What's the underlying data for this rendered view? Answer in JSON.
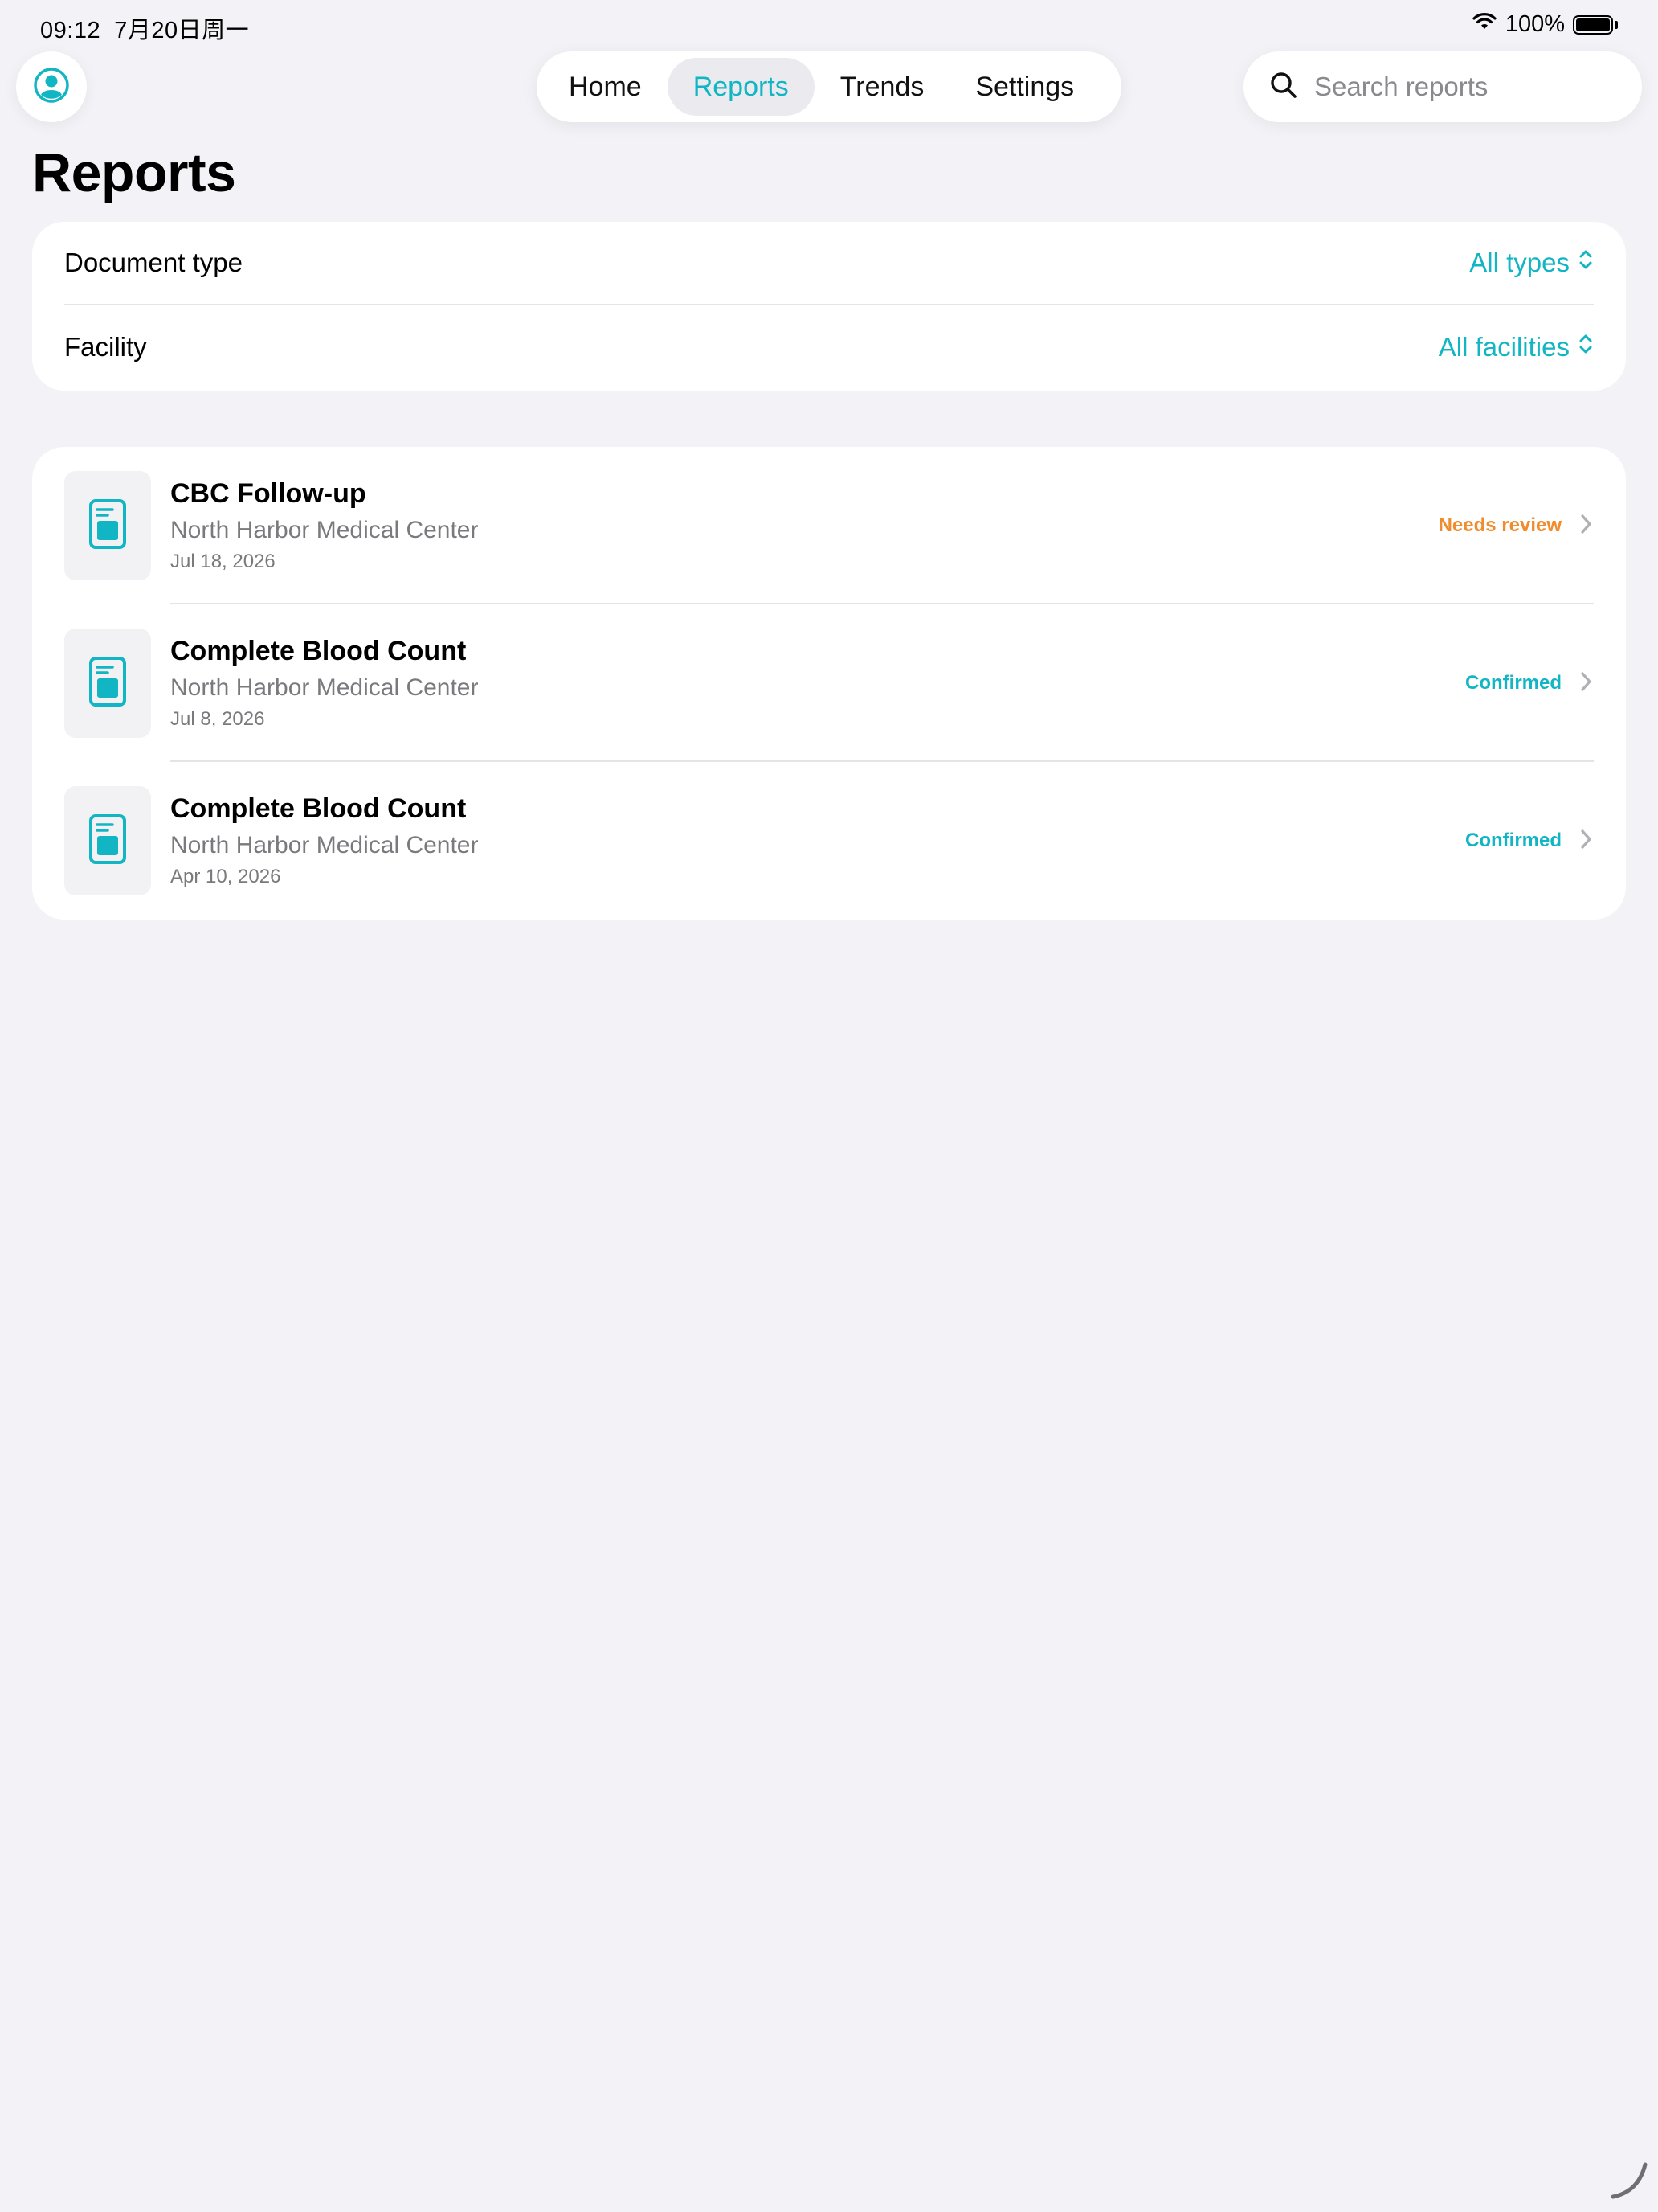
{
  "status_bar": {
    "time": "09:12",
    "date": "7月20日周一",
    "battery": "100%"
  },
  "nav": {
    "tabs": [
      {
        "label": "Home",
        "active": false
      },
      {
        "label": "Reports",
        "active": true
      },
      {
        "label": "Trends",
        "active": false
      },
      {
        "label": "Settings",
        "active": false
      }
    ],
    "search_placeholder": "Search reports"
  },
  "page": {
    "title": "Reports"
  },
  "filters": [
    {
      "label": "Document type",
      "value": "All types"
    },
    {
      "label": "Facility",
      "value": "All facilities"
    }
  ],
  "reports": [
    {
      "title": "CBC Follow-up",
      "facility": "North Harbor Medical Center",
      "date": "Jul 18, 2026",
      "status": "Needs review",
      "status_color": "#f08c2e"
    },
    {
      "title": "Complete Blood Count",
      "facility": "North Harbor Medical Center",
      "date": "Jul 8, 2026",
      "status": "Confirmed",
      "status_color": "#12b5c4"
    },
    {
      "title": "Complete Blood Count",
      "facility": "North Harbor Medical Center",
      "date": "Apr 10, 2026",
      "status": "Confirmed",
      "status_color": "#12b5c4"
    }
  ],
  "colors": {
    "accent": "#12b5c4",
    "warning": "#f08c2e",
    "background": "#f2f2f7"
  }
}
